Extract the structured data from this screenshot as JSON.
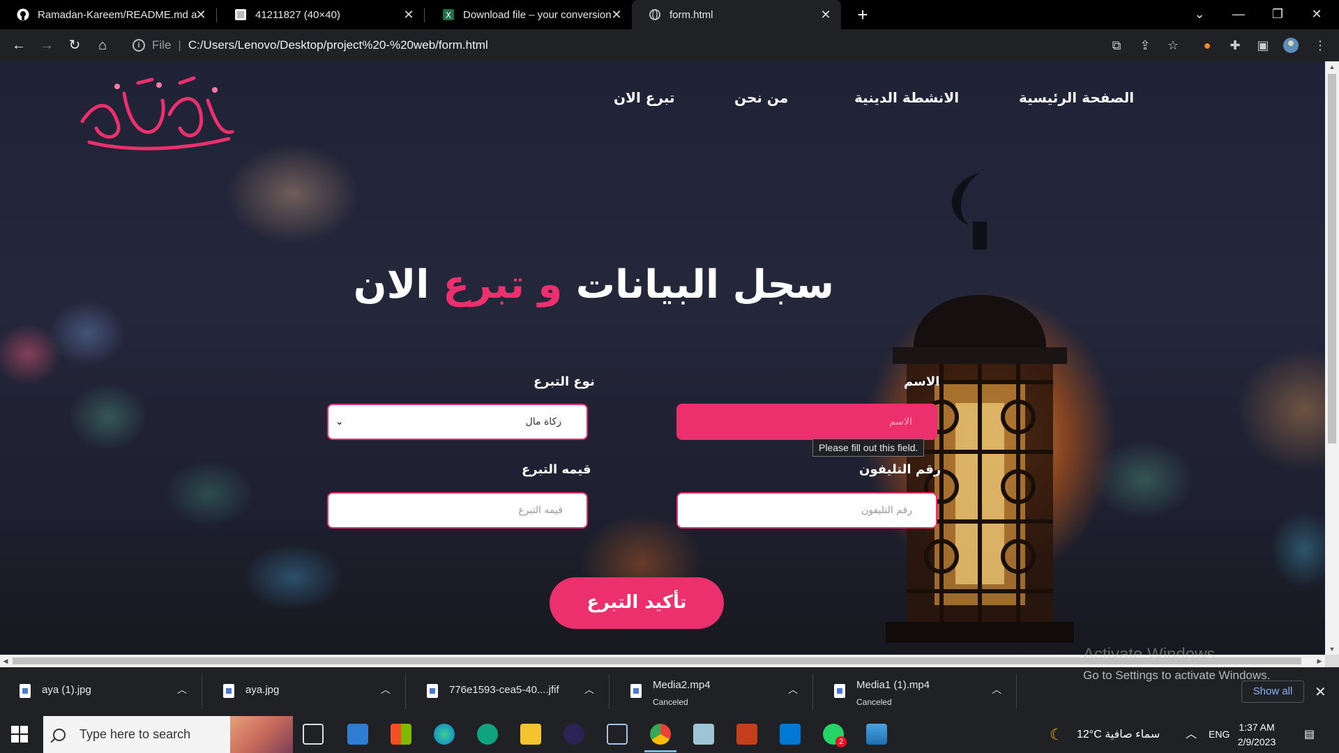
{
  "browser": {
    "tabs": [
      {
        "title": "Ramadan-Kareem/README.md a",
        "icon": "github-icon",
        "active": false
      },
      {
        "title": "41211827 (40×40)",
        "icon": "image-icon",
        "active": false
      },
      {
        "title": "Download file – your conversion",
        "icon": "excel-icon",
        "active": false
      },
      {
        "title": "form.html",
        "icon": "globe-icon",
        "active": true
      }
    ],
    "address": {
      "scheme_label": "File",
      "url": "C:/Users/Lenovo/Desktop/project%20-%20web/form.html"
    }
  },
  "page": {
    "nav": {
      "home": "الصفحة الرئيسية",
      "activities": "الانشطة الدينية",
      "about": "من نحن",
      "donate": "تبرع الان"
    },
    "headline": {
      "part1": "سجل البيانات",
      "part2": "و تبرع",
      "part3": "الان"
    },
    "form": {
      "name_label": "الاسم",
      "name_placeholder": "الاسم",
      "type_label": "نوع التبرع",
      "type_selected": "زكاة مال",
      "phone_label": "رقم التليفون",
      "phone_placeholder": "رقم التليفون",
      "amount_label": "قيمه التبرع",
      "amount_placeholder": "قيمه التبرع",
      "validation_tooltip": "Please fill out this field.",
      "submit": "تأكيد التبرع"
    },
    "colors": {
      "accent": "#ec2f6d",
      "background": "#202236"
    }
  },
  "downloads": {
    "items": [
      {
        "name": "aya (1).jpg",
        "status": ""
      },
      {
        "name": "aya.jpg",
        "status": ""
      },
      {
        "name": "776e1593-cea5-40....jfif",
        "status": ""
      },
      {
        "name": "Media2.mp4",
        "status": "Canceled"
      },
      {
        "name": "Media1 (1).mp4",
        "status": "Canceled"
      }
    ],
    "show_all": "Show all"
  },
  "watermark": {
    "line1": "Activate Windows",
    "line2": "Go to Settings to activate Windows."
  },
  "taskbar": {
    "search_placeholder": "Type here to search",
    "weather": "12°C  سماء صافية",
    "language": "ENG",
    "time": "1:37 AM",
    "date": "2/9/2023",
    "whatsapp_badge": "2"
  }
}
